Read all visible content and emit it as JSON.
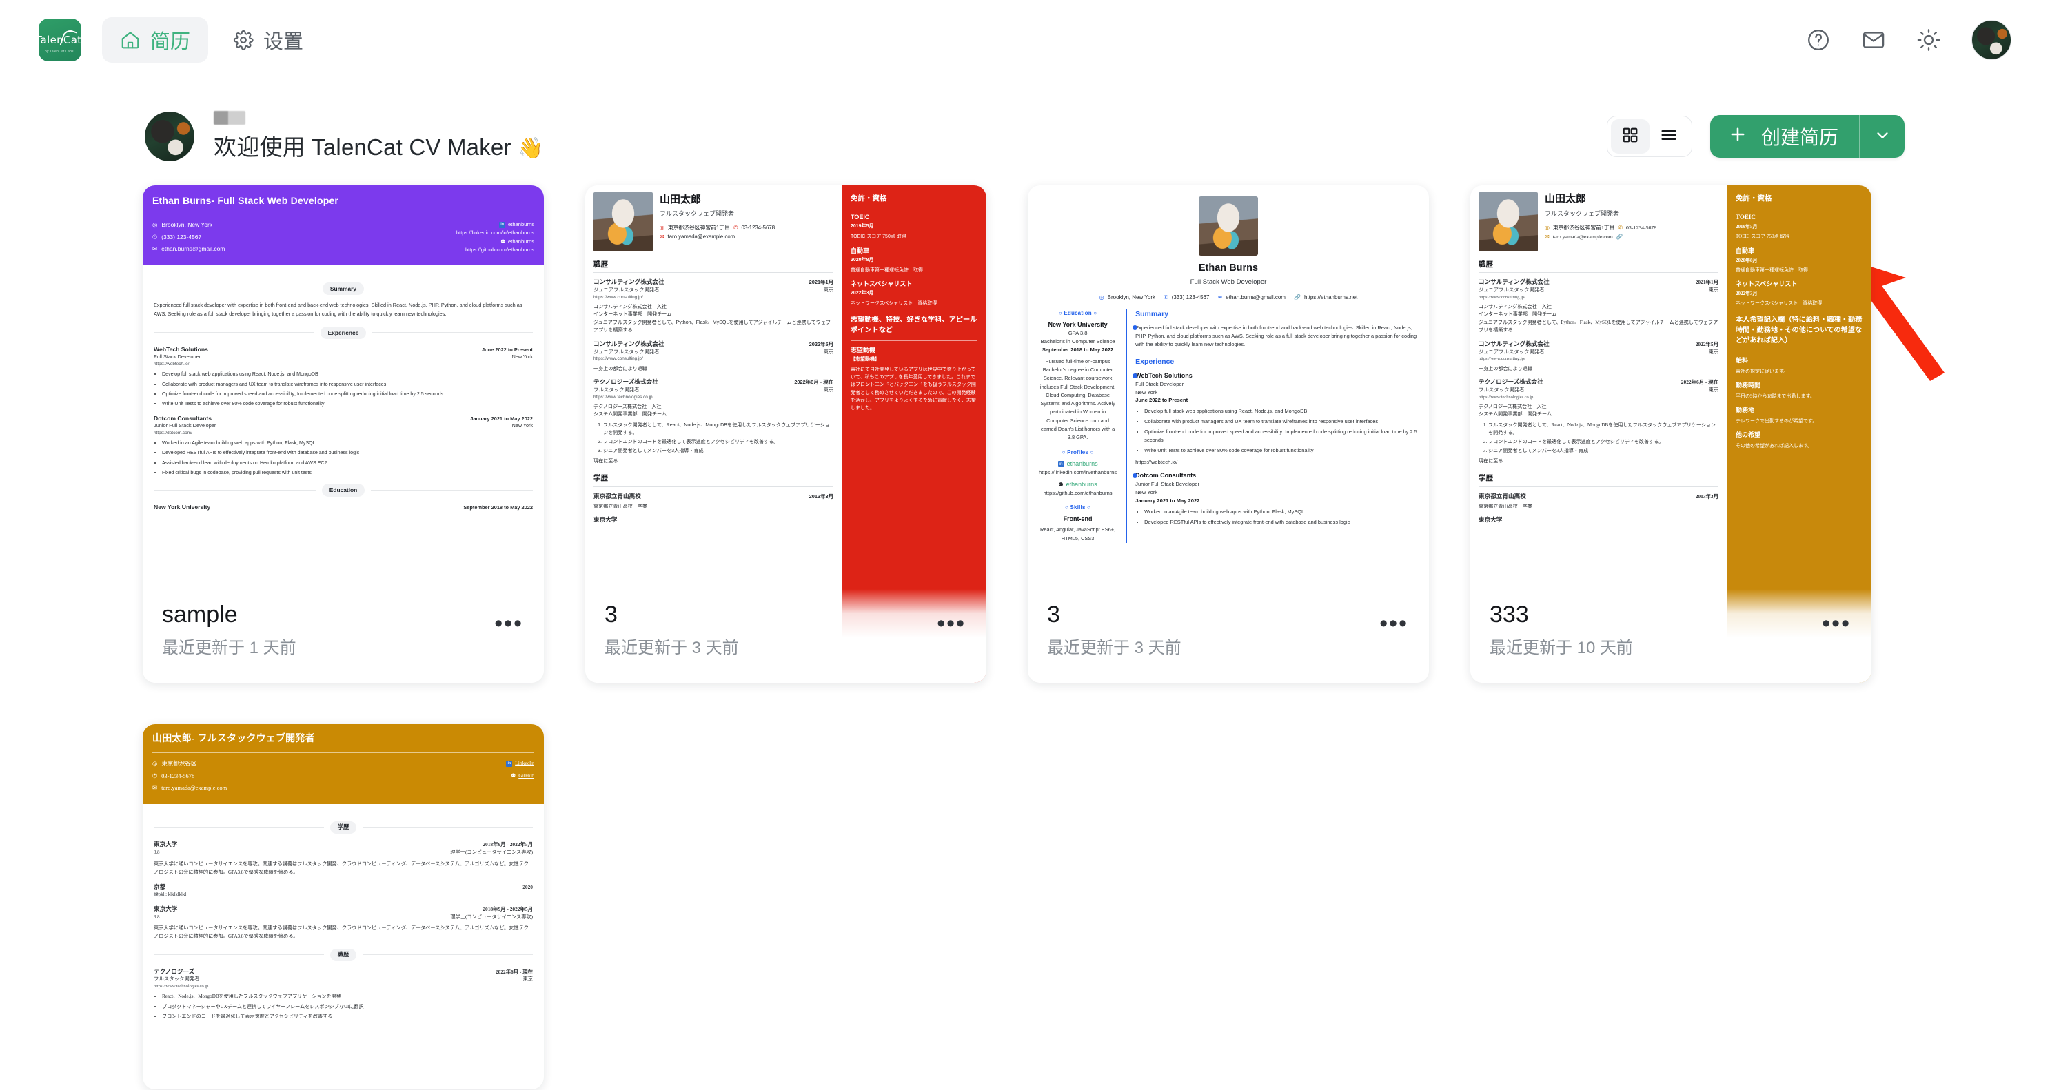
{
  "app": {
    "brand_name": "TalenCat",
    "brand_tagline": "by TalenCat Labs"
  },
  "nav": {
    "items": [
      {
        "label": "简历",
        "icon": "home-icon",
        "active": true
      },
      {
        "label": "设置",
        "icon": "gear-icon",
        "active": false
      }
    ],
    "right_icons": [
      "help-circle-icon",
      "mail-icon",
      "sun-icon",
      "avatar"
    ]
  },
  "welcome": {
    "redacted_name": "",
    "title": "欢迎使用 TalenCat CV Maker",
    "wave": "👋"
  },
  "toolbar": {
    "grid_view": "grid-view-icon",
    "list_view": "list-view-icon",
    "create_label": "创建简历",
    "create_plus": "+",
    "create_caret": "⌄",
    "accent_color": "#32a06d"
  },
  "annotation": {
    "arrow_color": "#f72a0d",
    "points_at": "创建简历"
  },
  "cards": [
    {
      "title": "sample",
      "updated": "最近更新于 1 天前",
      "more": "•••",
      "template": "purple-header",
      "accent": "#7c3aed"
    },
    {
      "title": "3",
      "updated": "最近更新于 3 天前",
      "more": "•••",
      "template": "jp-red",
      "accent": "#dd2316"
    },
    {
      "title": "3",
      "updated": "最近更新于 3 天前",
      "more": "•••",
      "template": "ethan-photo",
      "accent": "#2563eb"
    },
    {
      "title": "333",
      "updated": "最近更新于 10 天前",
      "more": "•••",
      "template": "jp-gold",
      "accent": "#c8890c"
    },
    {
      "title": "",
      "updated": "",
      "more": "",
      "template": "orange-header-jp",
      "accent": "#ca8a04"
    }
  ],
  "resume_en": {
    "header_title": "Ethan Burns- Full Stack Web Developer",
    "location": "Brooklyn, New York",
    "phone": "(333) 123-4567",
    "email": "ethan.burns@gmail.com",
    "linkedin_handle": "ethanburns",
    "linkedin_url": "https://linkedin.com/in/ethanburns",
    "github_handle": "ethanburns",
    "github_url": "https://github.com/ethanburns",
    "website": "https://ethanburns.net",
    "name": "Ethan Burns",
    "role": "Full Stack Web Developer",
    "sections": {
      "summary": "Summary",
      "experience": "Experience",
      "education": "Education",
      "profiles": "Profiles",
      "skills": "Skills"
    },
    "summary_text": "Experienced full stack developer with expertise in both front-end and back-end web technologies. Skilled in React, Node.js, PHP, Python, and cloud platforms such as AWS. Seeking role as a full stack developer bringing together a passion for coding with the ability to quickly learn new technologies.",
    "experience": [
      {
        "org": "WebTech Solutions",
        "role": "Full Stack Developer",
        "url": "https://webtech.io/",
        "dates": "June 2022 to Present",
        "location": "New York",
        "bullets": [
          "Develop full stack web applications using React, Node.js, and MongoDB",
          "Collaborate with product managers and UX team to translate wireframes into responsive user interfaces",
          "Optimize front-end code for improved speed and accessibility; Implemented code splitting reducing initial load time by 2.5 seconds",
          "Write Unit Tests to achieve over 80% code coverage for robust functionality"
        ]
      },
      {
        "org": "Dotcom Consultants",
        "role": "Junior Full Stack Developer",
        "url": "https://dotcom.com/",
        "dates": "January 2021 to May 2022",
        "location": "New York",
        "bullets": [
          "Worked in an Agile team building web apps with Python, Flask, MySQL",
          "Developed RESTful APIs to effectively integrate front-end with database and business logic",
          "Assisted back-end lead with deployments on Heroku platform and AWS EC2",
          "Fixed critical bugs in codebase, providing pull requests with unit tests"
        ]
      }
    ],
    "education": {
      "school": "New York University",
      "dates": "September 2018 to May 2022",
      "gpa": "GPA 3.8",
      "degree": "Bachelor's in Computer Science",
      "detail": "Pursued full-time on-campus Bachelor's degree in Computer Science. Relevant coursework includes Full Stack Development, Cloud Computing, Database Systems and Algorithms. Actively participated in Women in Computer Science club and earned Dean's List honors with a 3.8 GPA."
    },
    "skills": {
      "group": "Front-end",
      "items": "React, Angular, JavaScript ES6+, HTML5, CSS3"
    }
  },
  "resume_jp": {
    "name": "山田太郎",
    "role": "フルスタックウェブ開発者",
    "address": "東京都渋谷区神宮前1丁目",
    "phone": "03-1234-5678",
    "email": "taro.yamada@example.com",
    "sec_work": "職歴",
    "sec_edu": "学歴",
    "work": [
      {
        "org": "コンサルティング株式会社",
        "role": "ジュニアフルスタック開発者",
        "url": "https://www.consulting.jp/",
        "date": "2021年1月",
        "loc": "東京",
        "lines": [
          "コンサルティング株式会社　入社",
          "インターネット事業部　開発チーム",
          "ジュニアフルスタック開発者として、Python、Flask、MySQLを使用してアジャイルチームと連携してウェブアプリを構築する"
        ]
      },
      {
        "org": "コンサルティング株式会社",
        "role": "ジュニアフルスタック開発者",
        "url": "https://www.consulting.jp/",
        "date": "2022年5月",
        "loc": "東京",
        "lines": [
          "一身上の都合により退職"
        ]
      },
      {
        "org": "テクノロジーズ株式会社",
        "role": "フルスタック開発者",
        "url": "https://www.technologies.co.jp",
        "date": "2022年6月 - 現在",
        "loc": "東京",
        "lines": [
          "テクノロジーズ株式会社　入社",
          "システム開発事業部　開発チーム"
        ],
        "numbered": [
          "フルスタック開発者として、React、Node.js、MongoDBを使用したフルスタックウェブアプリケーションを開発する。",
          "フロントエンドのコードを最適化して表示速度とアクセシビリティを改善する。",
          "シニア開発者としてメンバーを3人指導・育成"
        ],
        "tail": "現在に至る"
      }
    ],
    "edu": [
      {
        "school": "東京都立青山高校",
        "date": "2013年3月",
        "note": "東京都立青山高校　卒業"
      },
      {
        "school": "東京大学",
        "date": "",
        "note": ""
      }
    ],
    "side": {
      "license_title": "免許・資格",
      "licenses": [
        {
          "name": "TOEIC",
          "date": "2019年5月",
          "desc": "TOEIC スコア 750点 取得"
        },
        {
          "name": "自動車",
          "date": "2020年8月",
          "desc": "普通自動車第一種運転免許　取得"
        },
        {
          "name": "ネットスペシャリスト",
          "date": "2022年3月",
          "desc": "ネットワークスペシャリスト　資格取得"
        }
      ],
      "motive_title": "志望動機、特技、好きな学科、アピールポイントなど",
      "motive_sub": "志望動機",
      "motive_tag": "【志望動機】",
      "motive_text": "貴社にて自社開発しているアプリは世界中で盛り上がっていて、私もこのアプリを長年愛用してきました。これまではフロントエンドとバックエンドをも扱うフルスタック開発者として務めさせていただきましたので、この開発経験を活かし、アプリをよりよくするために貢献したく、志望しました。",
      "wish_title": "本人希望記入欄（特に給料・職種・勤務時間・勤務地・その他についての希望などがあれば記入）",
      "wishes": [
        {
          "name": "給料",
          "desc": "貴社の規定に従います。"
        },
        {
          "name": "勤務時間",
          "desc": "平日の9時から18時まで出勤します。"
        },
        {
          "name": "勤務地",
          "desc": "テレワークで出勤するのが希望です。"
        },
        {
          "name": "他の希望",
          "desc": "その他の希望があれば記入します。"
        }
      ]
    }
  },
  "resume_jp_orange": {
    "header_title": "山田太郎- フルスタックウェブ開発者",
    "address": "東京都渋谷区",
    "phone": "03-1234-5678",
    "email": "taro.yamada@example.com",
    "linkedin_label": "LinkedIn",
    "github_label": "GitHub",
    "sec_edu": "学歴",
    "sec_work": "職歴",
    "edu": [
      {
        "school": "東京大学",
        "gpa": "3.8",
        "dates": "2018年9月 - 2022年5月",
        "degree": "理学士(コンピュータサイエンス専攻)",
        "detail": "東京大学に通いコンピュータサイエンスを専攻。関連する講義はフルスタック開発、クラウドコンピューティング、データベースシステム、アルゴリズムなど。女性テクノロジストの会に積極的に参加。GPA3.8で優秀な成績を修める。"
      },
      {
        "school": "京都",
        "gpa": "徐pkl ; klklklklkl",
        "dates": "2020",
        "degree": "",
        "detail": ""
      },
      {
        "school": "東京大学",
        "gpa": "3.8",
        "dates": "2018年9月 - 2022年5月",
        "degree": "理学士(コンピュータサイエンス専攻)",
        "detail": "東京大学に通いコンピュータサイエンスを専攻。関連する講義はフルスタック開発、クラウドコンピューティング、データベースシステム、アルゴリズムなど。女性テクノロジストの会に積極的に参加。GPA3.8で優秀な成績を修める。"
      }
    ],
    "work": [
      {
        "org": "テクノロジーズ",
        "role": "フルスタック開発者",
        "url": "https://www.technologies.co.jp",
        "dates": "2022年6月 - 現在",
        "loc": "東京",
        "bullets": [
          "React、Node.js、MongoDBを使用したフルスタックウェブアプリケーションを開発",
          "プロダクトマネージャーやUXチームと連携してワイヤーフレームをレスポンシブなUIに翻訳",
          "フロントエンドのコードを最適化して表示速度とアクセシビリティを改善する"
        ]
      }
    ]
  }
}
